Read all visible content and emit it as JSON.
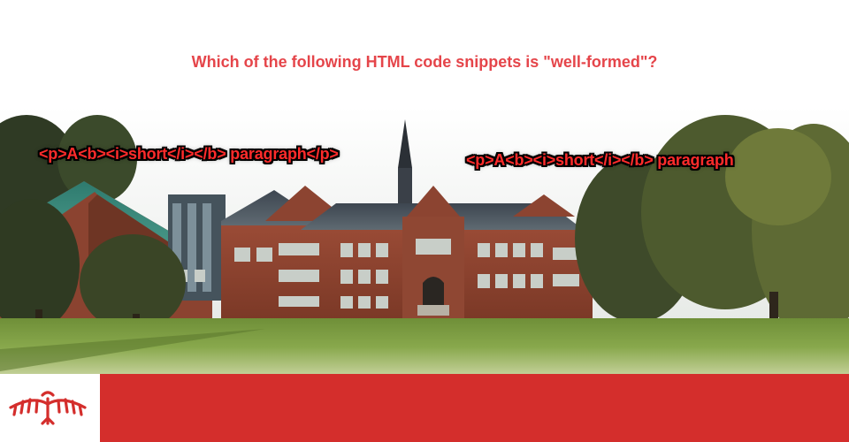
{
  "question": {
    "text": "Which of the following HTML code snippets is \"well-formed\"?"
  },
  "options": [
    {
      "code": "<p>A<b><i>short</i></b> paragraph</p>"
    },
    {
      "code": "<p>A<b><i>short</i></b> paragraph"
    }
  ],
  "colors": {
    "question": "#e5454a",
    "option_text": "#ff2b2b",
    "footer_bar": "#d42e2c",
    "logo": "#d42e2c"
  },
  "logo": {
    "icon": "thunderbird-logo-icon"
  },
  "background": {
    "icon": "campus-building-illustration"
  }
}
